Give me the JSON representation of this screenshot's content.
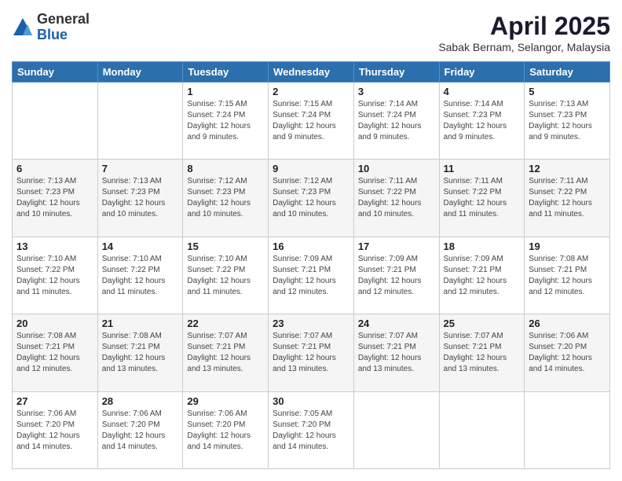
{
  "logo": {
    "general": "General",
    "blue": "Blue"
  },
  "header": {
    "title": "April 2025",
    "subtitle": "Sabak Bernam, Selangor, Malaysia"
  },
  "days_of_week": [
    "Sunday",
    "Monday",
    "Tuesday",
    "Wednesday",
    "Thursday",
    "Friday",
    "Saturday"
  ],
  "weeks": [
    [
      {
        "day": "",
        "info": ""
      },
      {
        "day": "",
        "info": ""
      },
      {
        "day": "1",
        "info": "Sunrise: 7:15 AM\nSunset: 7:24 PM\nDaylight: 12 hours and 9 minutes."
      },
      {
        "day": "2",
        "info": "Sunrise: 7:15 AM\nSunset: 7:24 PM\nDaylight: 12 hours and 9 minutes."
      },
      {
        "day": "3",
        "info": "Sunrise: 7:14 AM\nSunset: 7:24 PM\nDaylight: 12 hours and 9 minutes."
      },
      {
        "day": "4",
        "info": "Sunrise: 7:14 AM\nSunset: 7:23 PM\nDaylight: 12 hours and 9 minutes."
      },
      {
        "day": "5",
        "info": "Sunrise: 7:13 AM\nSunset: 7:23 PM\nDaylight: 12 hours and 9 minutes."
      }
    ],
    [
      {
        "day": "6",
        "info": "Sunrise: 7:13 AM\nSunset: 7:23 PM\nDaylight: 12 hours and 10 minutes."
      },
      {
        "day": "7",
        "info": "Sunrise: 7:13 AM\nSunset: 7:23 PM\nDaylight: 12 hours and 10 minutes."
      },
      {
        "day": "8",
        "info": "Sunrise: 7:12 AM\nSunset: 7:23 PM\nDaylight: 12 hours and 10 minutes."
      },
      {
        "day": "9",
        "info": "Sunrise: 7:12 AM\nSunset: 7:23 PM\nDaylight: 12 hours and 10 minutes."
      },
      {
        "day": "10",
        "info": "Sunrise: 7:11 AM\nSunset: 7:22 PM\nDaylight: 12 hours and 10 minutes."
      },
      {
        "day": "11",
        "info": "Sunrise: 7:11 AM\nSunset: 7:22 PM\nDaylight: 12 hours and 11 minutes."
      },
      {
        "day": "12",
        "info": "Sunrise: 7:11 AM\nSunset: 7:22 PM\nDaylight: 12 hours and 11 minutes."
      }
    ],
    [
      {
        "day": "13",
        "info": "Sunrise: 7:10 AM\nSunset: 7:22 PM\nDaylight: 12 hours and 11 minutes."
      },
      {
        "day": "14",
        "info": "Sunrise: 7:10 AM\nSunset: 7:22 PM\nDaylight: 12 hours and 11 minutes."
      },
      {
        "day": "15",
        "info": "Sunrise: 7:10 AM\nSunset: 7:22 PM\nDaylight: 12 hours and 11 minutes."
      },
      {
        "day": "16",
        "info": "Sunrise: 7:09 AM\nSunset: 7:21 PM\nDaylight: 12 hours and 12 minutes."
      },
      {
        "day": "17",
        "info": "Sunrise: 7:09 AM\nSunset: 7:21 PM\nDaylight: 12 hours and 12 minutes."
      },
      {
        "day": "18",
        "info": "Sunrise: 7:09 AM\nSunset: 7:21 PM\nDaylight: 12 hours and 12 minutes."
      },
      {
        "day": "19",
        "info": "Sunrise: 7:08 AM\nSunset: 7:21 PM\nDaylight: 12 hours and 12 minutes."
      }
    ],
    [
      {
        "day": "20",
        "info": "Sunrise: 7:08 AM\nSunset: 7:21 PM\nDaylight: 12 hours and 12 minutes."
      },
      {
        "day": "21",
        "info": "Sunrise: 7:08 AM\nSunset: 7:21 PM\nDaylight: 12 hours and 13 minutes."
      },
      {
        "day": "22",
        "info": "Sunrise: 7:07 AM\nSunset: 7:21 PM\nDaylight: 12 hours and 13 minutes."
      },
      {
        "day": "23",
        "info": "Sunrise: 7:07 AM\nSunset: 7:21 PM\nDaylight: 12 hours and 13 minutes."
      },
      {
        "day": "24",
        "info": "Sunrise: 7:07 AM\nSunset: 7:21 PM\nDaylight: 12 hours and 13 minutes."
      },
      {
        "day": "25",
        "info": "Sunrise: 7:07 AM\nSunset: 7:21 PM\nDaylight: 12 hours and 13 minutes."
      },
      {
        "day": "26",
        "info": "Sunrise: 7:06 AM\nSunset: 7:20 PM\nDaylight: 12 hours and 14 minutes."
      }
    ],
    [
      {
        "day": "27",
        "info": "Sunrise: 7:06 AM\nSunset: 7:20 PM\nDaylight: 12 hours and 14 minutes."
      },
      {
        "day": "28",
        "info": "Sunrise: 7:06 AM\nSunset: 7:20 PM\nDaylight: 12 hours and 14 minutes."
      },
      {
        "day": "29",
        "info": "Sunrise: 7:06 AM\nSunset: 7:20 PM\nDaylight: 12 hours and 14 minutes."
      },
      {
        "day": "30",
        "info": "Sunrise: 7:05 AM\nSunset: 7:20 PM\nDaylight: 12 hours and 14 minutes."
      },
      {
        "day": "",
        "info": ""
      },
      {
        "day": "",
        "info": ""
      },
      {
        "day": "",
        "info": ""
      }
    ]
  ]
}
